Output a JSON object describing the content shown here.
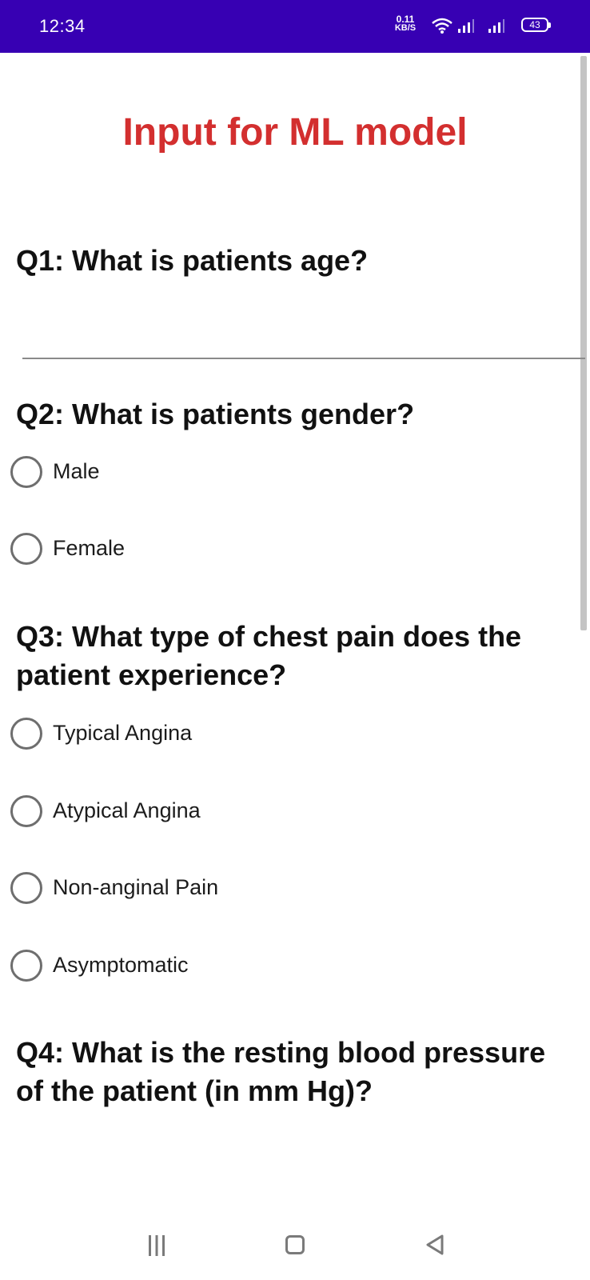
{
  "status_bar": {
    "time": "12:34",
    "speed_value": "0.11",
    "speed_unit": "KB/S",
    "battery": "43",
    "background": "#3700b3"
  },
  "page": {
    "title": "Input for ML model",
    "title_color": "#d32f2f"
  },
  "questions": {
    "q1": "Q1: What is patients age?",
    "q2": "Q2: What is patients gender?",
    "q3_line1": "Q3: What type of chest pain does the",
    "q3_line2": "patient experience?",
    "q4_line1": "Q4: What is the resting blood pressure",
    "q4_line2": "of the patient (in mm Hg)?"
  },
  "gender_options": [
    "Male",
    "Female"
  ],
  "chest_pain_options": [
    "Typical Angina",
    "Atypical Angina",
    "Non-anginal Pain",
    "Asymptomatic"
  ],
  "age_input": {
    "value": "",
    "placeholder": ""
  },
  "navigation": {
    "icons": [
      "menu-icon",
      "home-icon",
      "back-icon"
    ]
  }
}
